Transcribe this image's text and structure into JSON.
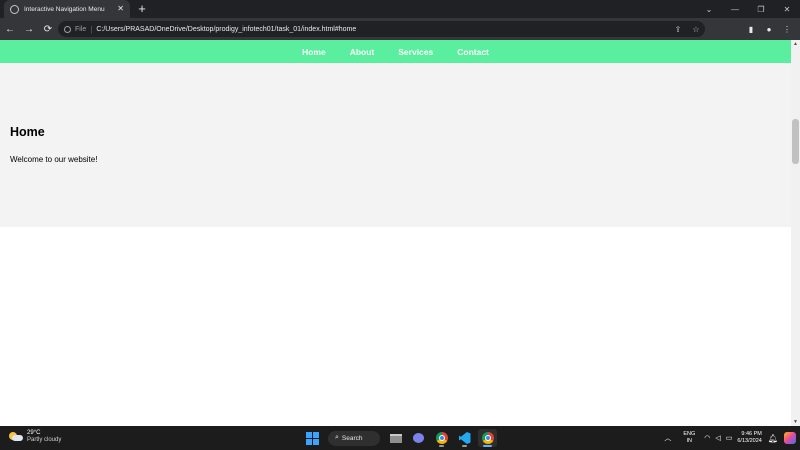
{
  "browser": {
    "tab_title": "Interactive Navigation Menu",
    "tab_close": "✕",
    "new_tab": "+",
    "window_minimize": "—",
    "window_restore": "❐",
    "window_close": "✕",
    "window_expand": "⌄",
    "back": "←",
    "forward": "→",
    "reload": "⟳",
    "url_scheme_label": "File",
    "url": "C:/Users/PRASAD/OneDrive/Desktop/prodigy_infotech01/task_01/index.html#home"
  },
  "site": {
    "nav": [
      "Home",
      "About",
      "Services",
      "Contact"
    ],
    "section_title": "Home",
    "section_text": "Welcome to our website!"
  },
  "taskbar": {
    "weather_temp": "29°C",
    "weather_desc": "Partly cloudy",
    "search_label": "Search",
    "lang_top": "ENG",
    "lang_bottom": "IN",
    "time": "9:46 PM",
    "date": "6/13/2024"
  },
  "colors": {
    "site_nav_bg": "#5aef9f",
    "section_bg": "#f3f3f3",
    "browser_dark": "#202124",
    "taskbar_bg": "#1c1c1c"
  }
}
